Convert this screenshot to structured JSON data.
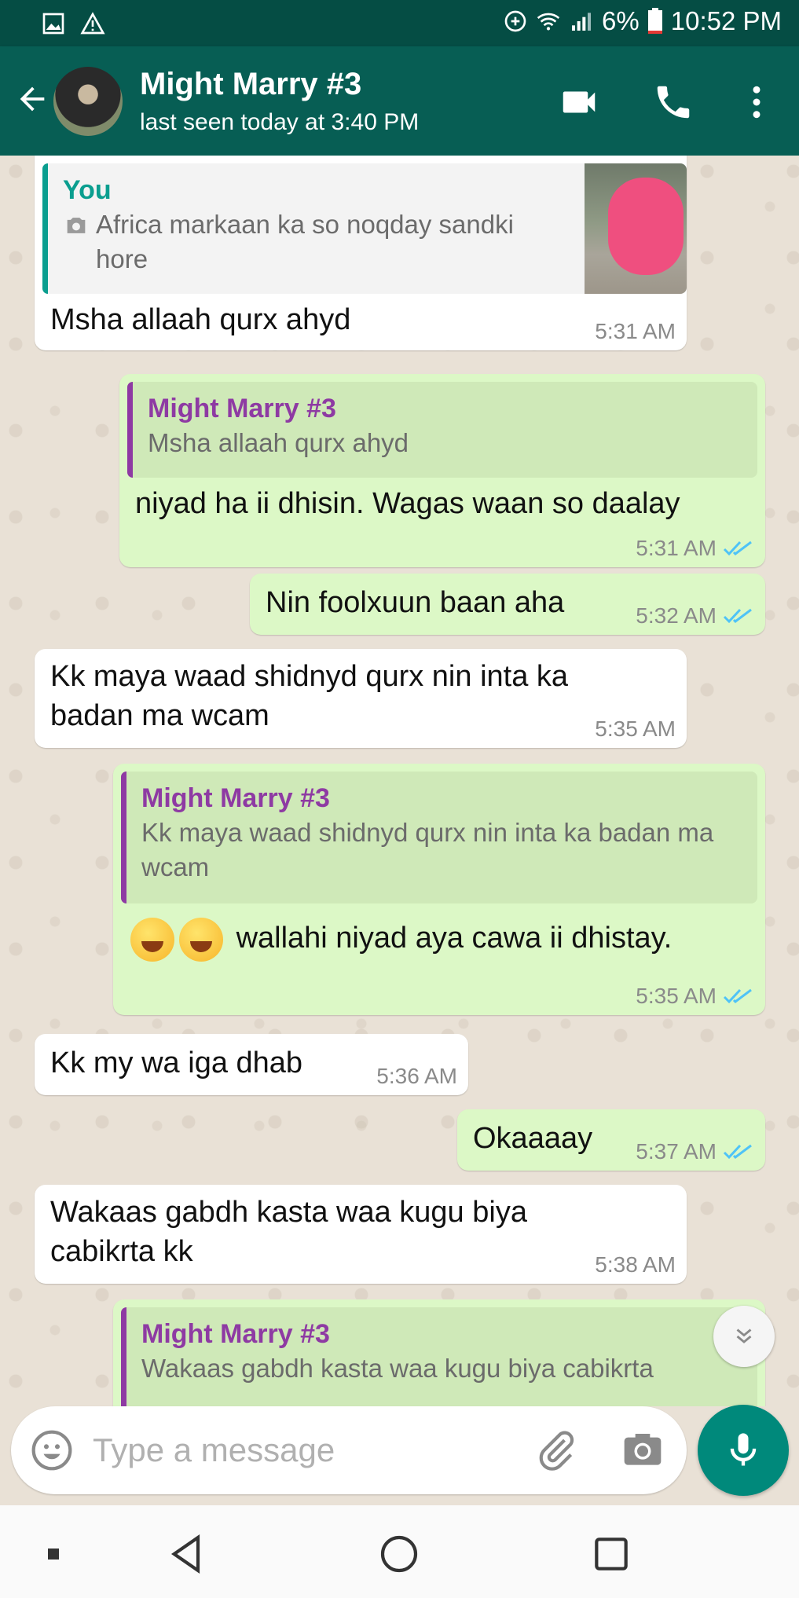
{
  "status_bar": {
    "battery": "6%",
    "time": "10:52 PM",
    "icons": [
      "image-icon",
      "warning-icon",
      "data-saver-icon",
      "wifi-icon",
      "signal-icon",
      "battery-icon"
    ]
  },
  "header": {
    "contact_name": "Might Marry #3",
    "last_seen": "last seen today at 3:40 PM",
    "icons": [
      "back-arrow-icon",
      "video-call-icon",
      "voice-call-icon",
      "more-options-icon"
    ]
  },
  "messages": [
    {
      "direction": "in",
      "quote_author": "You",
      "quote_text": "Africa markaan ka so noqday sandki hore",
      "text": "Msha allaah qurx ahyd",
      "time": "5:31 AM"
    },
    {
      "direction": "out",
      "quote_author": "Might Marry #3",
      "quote_text": "Msha allaah qurx ahyd",
      "text": "niyad ha ii dhisin. Wagas waan so daalay",
      "time": "5:31 AM"
    },
    {
      "direction": "out",
      "text": "Nin foolxuun baan aha",
      "time": "5:32 AM"
    },
    {
      "direction": "in",
      "text": "Kk maya waad shidnyd qurx nin inta ka badan ma wcam",
      "time": "5:35 AM"
    },
    {
      "direction": "out",
      "quote_author": "Might Marry #3",
      "quote_text": "Kk maya waad shidnyd qurx nin inta ka badan ma wcam",
      "text": "wallahi niyad aya cawa ii dhistay.",
      "time": "5:35 AM"
    },
    {
      "direction": "in",
      "text": "Kk my wa iga dhab",
      "time": "5:36 AM"
    },
    {
      "direction": "out",
      "text": "Okaaaay",
      "time": "5:37 AM"
    },
    {
      "direction": "in",
      "text": "Wakaas gabdh kasta waa kugu biya cabikrta kk",
      "time": "5:38 AM"
    },
    {
      "direction": "out",
      "quote_author": "Might Marry #3",
      "quote_text": "Wakaas gabdh kasta waa kugu biya cabikrta"
    }
  ],
  "composer": {
    "placeholder": "Type a message"
  },
  "colors": {
    "header": "#075e54",
    "status_bar": "#054d44",
    "outgoing_bubble": "#dcf8c6",
    "incoming_bubble": "#ffffff",
    "read_ticks": "#4fc3f7",
    "mic_button": "#00897b",
    "quote_author_purple": "#8e3aa3",
    "quote_author_teal": "#0a9e8f"
  }
}
